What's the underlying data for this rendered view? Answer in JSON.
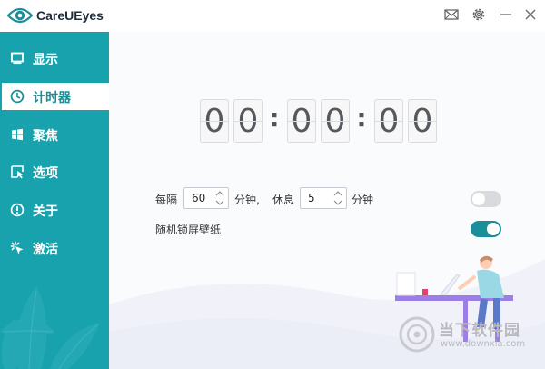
{
  "app": {
    "title": "CareUEyes"
  },
  "window_controls": [
    "mail-icon",
    "gear-icon",
    "minimize-icon",
    "close-icon"
  ],
  "sidebar": {
    "items": [
      {
        "label": "显示",
        "icon": "monitor-icon",
        "active": false
      },
      {
        "label": "计时器",
        "icon": "clock-icon",
        "active": true
      },
      {
        "label": "聚焦",
        "icon": "windows-icon",
        "active": false
      },
      {
        "label": "选项",
        "icon": "cursor-icon",
        "active": false
      },
      {
        "label": "关于",
        "icon": "info-icon",
        "active": false
      },
      {
        "label": "激活",
        "icon": "sparkle-icon",
        "active": false
      }
    ]
  },
  "timer": {
    "digits": [
      "0",
      "0",
      "0",
      "0",
      "0",
      "0"
    ],
    "separators": [
      ":",
      ":"
    ]
  },
  "break_settings": {
    "every_label": "每隔",
    "interval_value": "60",
    "minutes_comma_label": "分钟,",
    "rest_label": "休息",
    "rest_value": "5",
    "minutes_label": "分钟",
    "toggle_on": false
  },
  "wallpaper": {
    "label": "随机锁屏壁纸",
    "toggle_on": true
  },
  "colors": {
    "accent": "#18a2ad",
    "toggle_off": "#d9dadd",
    "toggle_on": "#1a8e99"
  },
  "watermark": {
    "name": "当下软件园",
    "url": "www.downxia.com"
  }
}
